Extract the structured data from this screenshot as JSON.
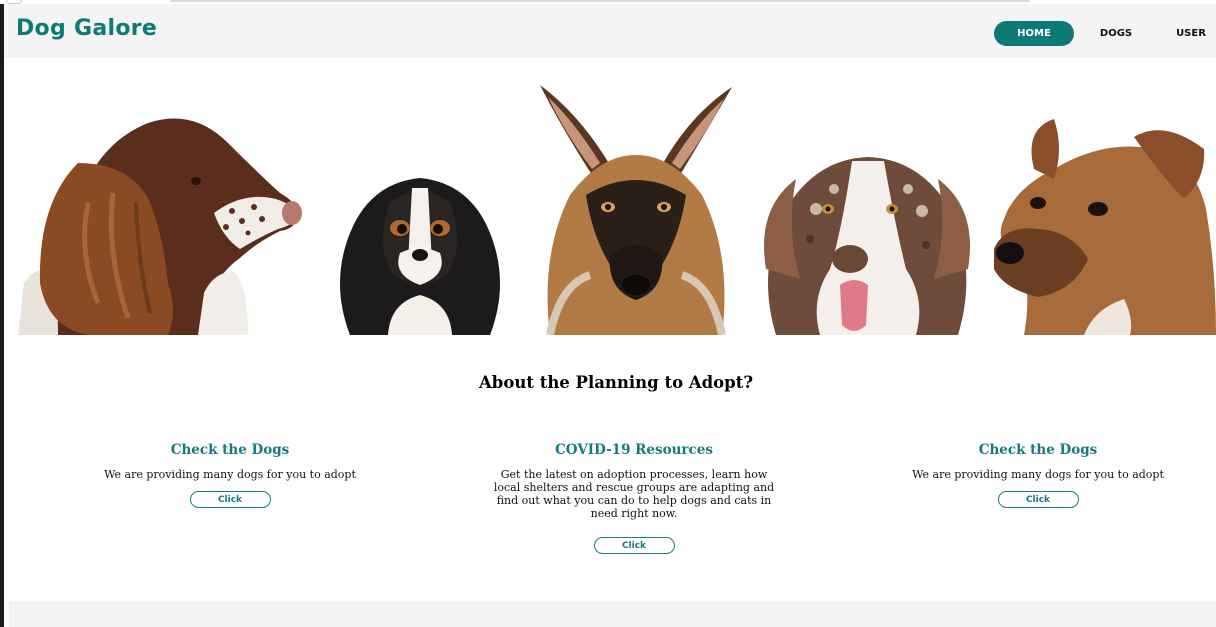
{
  "header": {
    "brand": "Dog Galore",
    "nav": [
      {
        "label": "HOME",
        "active": true
      },
      {
        "label": "DOGS",
        "active": false
      },
      {
        "label": "USER",
        "active": false
      }
    ]
  },
  "hero": {
    "images": [
      "springer-spaniel-dog",
      "cavalier-spaniel-dog",
      "german-shepherd-dog",
      "merle-shepherd-dog",
      "mixed-breed-dog"
    ]
  },
  "main": {
    "title": "About the Planning to Adopt?",
    "cards": [
      {
        "title": "Check the Dogs",
        "text": "We are providing many dogs for you to adopt",
        "button": "Click"
      },
      {
        "title": "COVID-19 Resources",
        "text": "Get the latest on adoption processes, learn how local shelters and rescue groups are adapting and find out what you can do to help dogs and cats in need right now.",
        "button": "Click"
      },
      {
        "title": "Check the Dogs",
        "text": "We are providing many dogs for you to adopt",
        "button": "Click"
      }
    ]
  },
  "colors": {
    "brand": "#0d7a78",
    "accent": "#137a7e",
    "header_bg": "#f4f4f4"
  }
}
